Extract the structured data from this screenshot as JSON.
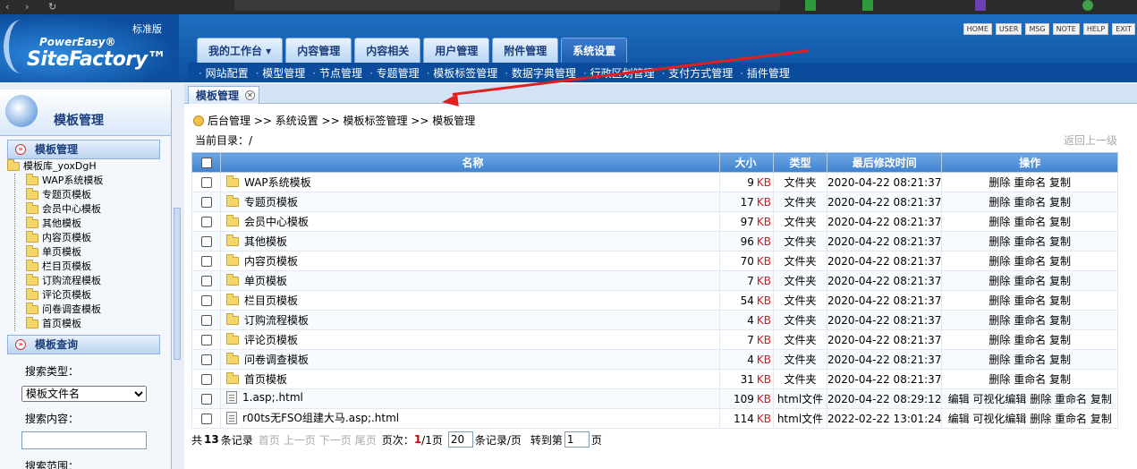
{
  "header": {
    "logo_line1": "PowerEasy®",
    "logo_line2": "SiteFactory™",
    "edition": "标准版",
    "toplinks": [
      "HOME",
      "USER",
      "MSG",
      "NOTE",
      "HELP",
      "EXIT"
    ],
    "tabs": [
      "我的工作台 ▾",
      "内容管理",
      "内容相关",
      "用户管理",
      "附件管理",
      "系统设置"
    ],
    "active_tab": "系统设置",
    "subnav": [
      "网站配置",
      "模型管理",
      "节点管理",
      "专题管理",
      "模板标签管理",
      "数据字典管理",
      "行政区划管理",
      "支付方式管理",
      "插件管理"
    ]
  },
  "sidebar": {
    "title": "模板管理",
    "section1": "模板管理",
    "root": "模板库_yoxDgH",
    "folders": [
      "WAP系统模板",
      "专题页模板",
      "会员中心模板",
      "其他模板",
      "内容页模板",
      "单页模板",
      "栏目页模板",
      "订购流程模板",
      "评论页模板",
      "问卷调查模板",
      "首页模板"
    ],
    "section2": "模板查询",
    "search_type_label": "搜索类型：",
    "search_type_value": "模板文件名",
    "search_content_label": "搜索内容：",
    "search_content_value": "",
    "search_range_label": "搜索范围："
  },
  "main": {
    "tab_label": "模板管理",
    "breadcrumb": "后台管理 >> 系统设置 >> 模板标签管理 >> 模板管理",
    "current_dir": "当前目录：/",
    "back_link": "返回上一级",
    "columns": [
      "名称",
      "大小",
      "类型",
      "最后修改时间",
      "操作"
    ],
    "rows": [
      {
        "icon": "folder",
        "name": "WAP系统模板",
        "size": "9",
        "unit": "KB",
        "type": "文件夹",
        "time": "2020-04-22 08:21:37",
        "ops": "删除 重命名 复制"
      },
      {
        "icon": "folder",
        "name": "专题页模板",
        "size": "17",
        "unit": "KB",
        "type": "文件夹",
        "time": "2020-04-22 08:21:37",
        "ops": "删除 重命名 复制"
      },
      {
        "icon": "folder",
        "name": "会员中心模板",
        "size": "97",
        "unit": "KB",
        "type": "文件夹",
        "time": "2020-04-22 08:21:37",
        "ops": "删除 重命名 复制"
      },
      {
        "icon": "folder",
        "name": "其他模板",
        "size": "96",
        "unit": "KB",
        "type": "文件夹",
        "time": "2020-04-22 08:21:37",
        "ops": "删除 重命名 复制"
      },
      {
        "icon": "folder",
        "name": "内容页模板",
        "size": "70",
        "unit": "KB",
        "type": "文件夹",
        "time": "2020-04-22 08:21:37",
        "ops": "删除 重命名 复制"
      },
      {
        "icon": "folder",
        "name": "单页模板",
        "size": "7",
        "unit": "KB",
        "type": "文件夹",
        "time": "2020-04-22 08:21:37",
        "ops": "删除 重命名 复制"
      },
      {
        "icon": "folder",
        "name": "栏目页模板",
        "size": "54",
        "unit": "KB",
        "type": "文件夹",
        "time": "2020-04-22 08:21:37",
        "ops": "删除 重命名 复制"
      },
      {
        "icon": "folder",
        "name": "订购流程模板",
        "size": "4",
        "unit": "KB",
        "type": "文件夹",
        "time": "2020-04-22 08:21:37",
        "ops": "删除 重命名 复制"
      },
      {
        "icon": "folder",
        "name": "评论页模板",
        "size": "7",
        "unit": "KB",
        "type": "文件夹",
        "time": "2020-04-22 08:21:37",
        "ops": "删除 重命名 复制"
      },
      {
        "icon": "folder",
        "name": "问卷调查模板",
        "size": "4",
        "unit": "KB",
        "type": "文件夹",
        "time": "2020-04-22 08:21:37",
        "ops": "删除 重命名 复制"
      },
      {
        "icon": "folder",
        "name": "首页模板",
        "size": "31",
        "unit": "KB",
        "type": "文件夹",
        "time": "2020-04-22 08:21:37",
        "ops": "删除 重命名 复制"
      },
      {
        "icon": "file",
        "name": "1.asp;.html",
        "size": "109",
        "unit": "KB",
        "type": "html文件",
        "time": "2020-04-22 08:29:12",
        "ops": "编辑 可视化编辑 删除 重命名 复制"
      },
      {
        "icon": "file",
        "name": "r00ts无FSO组建大马.asp;.html",
        "size": "114",
        "unit": "KB",
        "type": "html文件",
        "time": "2022-02-22 13:01:24",
        "ops": "编辑 可视化编辑 删除 重命名 复制"
      }
    ],
    "pager": {
      "total_prefix": "共",
      "total": "13",
      "total_suffix": "条记录",
      "first": "首页",
      "prev": "上一页",
      "next": "下一页",
      "last": "尾页",
      "page_label": "页次：",
      "page_current": "1",
      "page_total": "/1页",
      "per_page": "20",
      "per_page_suffix": "条记录/页",
      "goto_label": "转到第",
      "goto_value": "1",
      "goto_suffix": "页"
    }
  },
  "colors": {
    "header_blue": "#0b4b9c",
    "kb_red": "#d21a1a",
    "annotation_arrow": "#e02020"
  }
}
